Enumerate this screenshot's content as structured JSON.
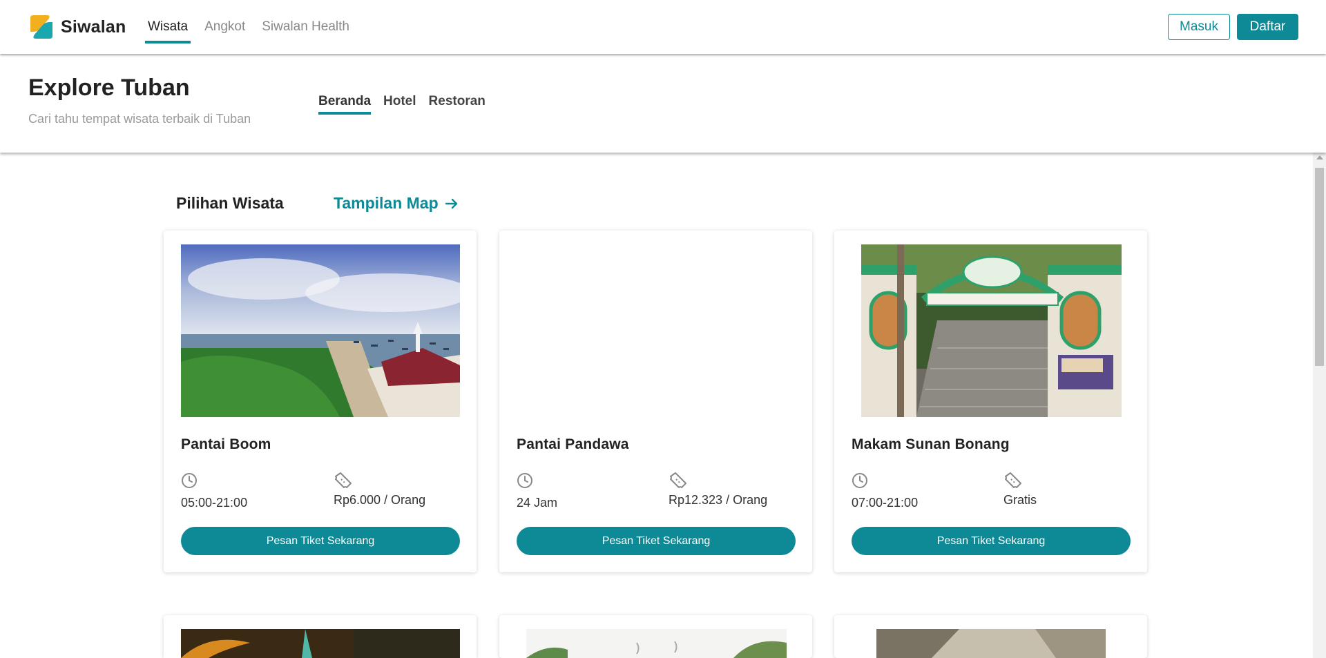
{
  "navbar": {
    "brand": "Siwalan",
    "links": [
      {
        "label": "Wisata",
        "active": true
      },
      {
        "label": "Angkot",
        "active": false
      },
      {
        "label": "Siwalan Health",
        "active": false
      }
    ],
    "login_label": "Masuk",
    "register_label": "Daftar"
  },
  "subheader": {
    "title": "Explore Tuban",
    "caption": "Cari tahu tempat wisata terbaik di Tuban",
    "tabs": [
      {
        "label": "Beranda",
        "active": true
      },
      {
        "label": "Hotel",
        "active": false
      },
      {
        "label": "Restoran",
        "active": false
      }
    ]
  },
  "main": {
    "section_title": "Pilihan Wisata",
    "map_link": "Tampilan Map",
    "cards": [
      {
        "name": "Pantai Boom",
        "hours": "05:00-21:00",
        "price": "Rp6.000 / Orang",
        "button": "Pesan Tiket Sekarang",
        "image": "beach-pier-photo"
      },
      {
        "name": "Pantai Pandawa",
        "hours": "24 Jam",
        "price": "Rp12.323 / Orang",
        "button": "Pesan Tiket Sekarang",
        "image": "blank"
      },
      {
        "name": "Makam Sunan Bonang",
        "hours": "07:00-21:00",
        "price": "Gratis",
        "button": "Pesan Tiket Sekarang",
        "image": "tomb-gate-photo"
      }
    ]
  },
  "colors": {
    "accent": "#0e8a96",
    "muted_text": "#9a9a9a"
  },
  "icons": [
    "logo-mark",
    "clock-icon",
    "ticket-icon",
    "arrow-right-icon"
  ]
}
